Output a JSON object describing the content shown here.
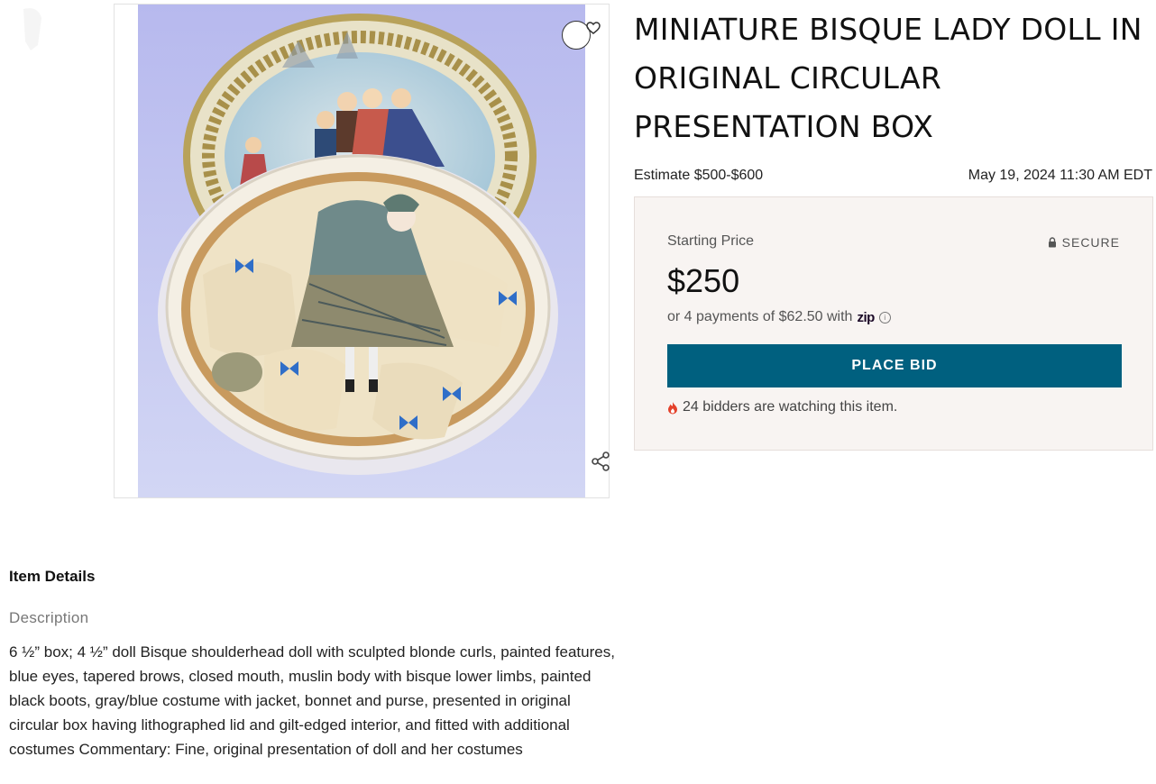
{
  "lot": {
    "title": "MINIATURE BISQUE LADY DOLL IN ORIGINAL CIRCULAR PRESENTATION BOX",
    "estimate": "Estimate $500-$600",
    "sale_date": "May 19, 2024 11:30 AM EDT"
  },
  "bid_panel": {
    "starting_price_label": "Starting Price",
    "secure_label": "SECURE",
    "price": "$250",
    "payments_text": "or 4 payments of $62.50 with",
    "payment_provider": "zip",
    "place_bid_label": "PLACE BID",
    "watchers_text": "24 bidders are watching this item.",
    "accent_color": "#00607f"
  },
  "details": {
    "heading": "Item Details",
    "description_label": "Description",
    "description_text": "6 ½” box; 4 ½” doll   Bisque shoulderhead doll with sculpted blonde curls, painted features, blue eyes, tapered brows, closed mouth, muslin body with bisque lower limbs, painted black boots, gray/blue costume with jacket, bonnet and purse, presented in original circular box having lithographed lid and gilt-edged interior, and fitted with additional costumes   Commentary: Fine, original presentation of doll and her costumes"
  },
  "icons": {
    "favorite": "heart-icon",
    "share": "share-icon",
    "secure": "lock-icon",
    "watchers": "flame-icon",
    "info": "info-icon"
  }
}
